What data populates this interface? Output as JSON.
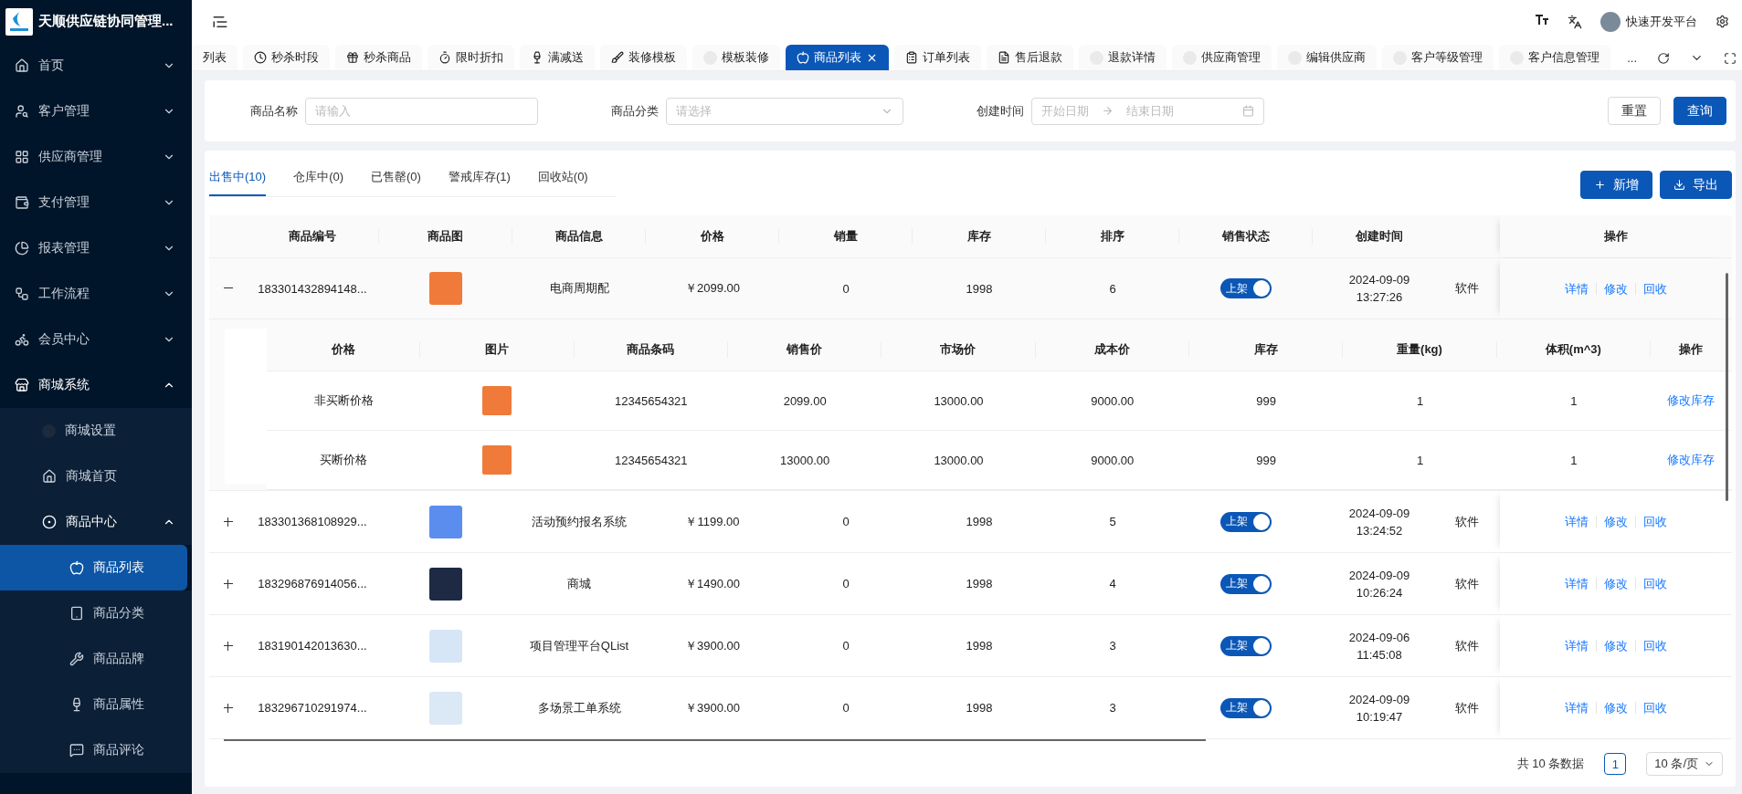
{
  "brand": {
    "title": "天顺供应链协同管理..."
  },
  "user": {
    "name": "快速开发平台"
  },
  "sidebar": {
    "items": [
      {
        "label": "首页",
        "expanded": false,
        "selected": false
      },
      {
        "label": "客户管理",
        "expanded": false,
        "selected": false
      },
      {
        "label": "供应商管理",
        "expanded": false,
        "selected": false
      },
      {
        "label": "支付管理",
        "expanded": false,
        "selected": false
      },
      {
        "label": "报表管理",
        "expanded": false,
        "selected": false
      },
      {
        "label": "工作流程",
        "expanded": false,
        "selected": false
      },
      {
        "label": "会员中心",
        "expanded": false,
        "selected": false
      },
      {
        "label": "商城系统",
        "expanded": true,
        "selected": false,
        "children": [
          {
            "label": "商城设置",
            "selected": false
          },
          {
            "label": "商城首页",
            "selected": false
          },
          {
            "label": "商品中心",
            "expanded": true,
            "selected": false,
            "children": [
              {
                "label": "商品列表",
                "selected": true
              },
              {
                "label": "商品分类",
                "selected": false
              },
              {
                "label": "商品品牌",
                "selected": false
              },
              {
                "label": "商品属性",
                "selected": false
              },
              {
                "label": "商品评论",
                "selected": false
              }
            ]
          }
        ]
      }
    ]
  },
  "tabs": [
    {
      "label": "列表",
      "selected": false,
      "closable": false
    },
    {
      "label": "秒杀时段",
      "selected": false,
      "closable": false
    },
    {
      "label": "秒杀商品",
      "selected": false,
      "closable": false
    },
    {
      "label": "限时折扣",
      "selected": false,
      "closable": false
    },
    {
      "label": "满减送",
      "selected": false,
      "closable": false
    },
    {
      "label": "装修模板",
      "selected": false,
      "closable": false
    },
    {
      "label": "模板装修",
      "selected": false,
      "closable": false
    },
    {
      "label": "商品列表",
      "selected": true,
      "closable": true
    },
    {
      "label": "订单列表",
      "selected": false,
      "closable": false
    },
    {
      "label": "售后退款",
      "selected": false,
      "closable": false
    },
    {
      "label": "退款详情",
      "selected": false,
      "closable": false
    },
    {
      "label": "供应商管理",
      "selected": false,
      "closable": false
    },
    {
      "label": "编辑供应商",
      "selected": false,
      "closable": false
    },
    {
      "label": "客户等级管理",
      "selected": false,
      "closable": false
    },
    {
      "label": "客户信息管理",
      "selected": false,
      "closable": false
    }
  ],
  "tabs_more": "...",
  "filters": [
    {
      "kind": "input",
      "label": "商品名称",
      "placeholder": "请输入"
    },
    {
      "kind": "select",
      "label": "商品分类",
      "placeholder": "请选择"
    },
    {
      "kind": "range",
      "label": "创建时间",
      "placeholder": "开始日期",
      "placeholder_end": "结束日期"
    }
  ],
  "filter_buttons": [
    {
      "label": "重置",
      "kind": "default"
    },
    {
      "label": "查询",
      "kind": "primary"
    }
  ],
  "status_tabs": [
    {
      "label": "出售中(10)",
      "selected": true
    },
    {
      "label": "仓库中(0)",
      "selected": false
    },
    {
      "label": "已售罄(0)",
      "selected": false
    },
    {
      "label": "警戒库存(1)",
      "selected": false
    },
    {
      "label": "回收站(0)",
      "selected": false
    }
  ],
  "actions": [
    {
      "label": "新增",
      "kind": "add"
    },
    {
      "label": "导出",
      "kind": "export"
    }
  ],
  "table": {
    "columns": [
      "商品编号",
      "商品图",
      "商品信息",
      "价格",
      "销量",
      "库存",
      "排序",
      "销售状态",
      "创建时间"
    ],
    "actions_header": "操作",
    "rows": [
      {
        "expanded": true,
        "id": "183301432894148...",
        "title": "电商周期配",
        "price": "￥2099.00",
        "sales": "0",
        "stock": "1998",
        "sort": "6",
        "on": true,
        "status": "上架",
        "created_date": "2024-09-09",
        "created_time": "13:27:26",
        "column_10": "软件",
        "actions": [
          "详情",
          "修改",
          "回收"
        ],
        "sub_table": {
          "columns": [
            "价格",
            "图片",
            "商品条码",
            "销售价",
            "市场价",
            "成本价",
            "库存",
            "重量(kg)",
            "体积(m^3)"
          ],
          "actions_header": "操作",
          "rows": [
            {
              "name": "非买断价格",
              "barcode": "12345654321",
              "sale_price": "2099.00",
              "market_price": "13000.00",
              "cost_price": "9000.00",
              "stock": "999",
              "weight": "1",
              "volume": "1",
              "action": "修改库存"
            },
            {
              "name": "买断价格",
              "barcode": "12345654321",
              "sale_price": "13000.00",
              "market_price": "13000.00",
              "cost_price": "9000.00",
              "stock": "999",
              "weight": "1",
              "volume": "1",
              "action": "修改库存"
            }
          ]
        }
      },
      {
        "expanded": false,
        "id": "183301368108929...",
        "title": "活动预约报名系统",
        "price": "￥1199.00",
        "sales": "0",
        "stock": "1998",
        "sort": "5",
        "on": true,
        "status": "上架",
        "created_date": "2024-09-09",
        "created_time": "13:24:52",
        "column_10": "软件",
        "actions": [
          "详情",
          "修改",
          "回收"
        ]
      },
      {
        "expanded": false,
        "id": "183296876914056...",
        "title": "商城",
        "price": "￥1490.00",
        "sales": "0",
        "stock": "1998",
        "sort": "4",
        "on": true,
        "status": "上架",
        "created_date": "2024-09-09",
        "created_time": "10:26:24",
        "column_10": "软件",
        "actions": [
          "详情",
          "修改",
          "回收"
        ]
      },
      {
        "expanded": false,
        "id": "183190142013630...",
        "title": "项目管理平台QList",
        "price": "￥3900.00",
        "sales": "0",
        "stock": "1998",
        "sort": "3",
        "on": true,
        "status": "上架",
        "created_date": "2024-09-06",
        "created_time": "11:45:08",
        "column_10": "软件",
        "actions": [
          "详情",
          "修改",
          "回收"
        ]
      },
      {
        "expanded": false,
        "id": "183296710291974...",
        "title": "多场景工单系统",
        "price": "￥3900.00",
        "sales": "0",
        "stock": "1998",
        "sort": "3",
        "on": true,
        "status": "上架",
        "created_date": "2024-09-09",
        "created_time": "10:19:47",
        "column_10": "软件",
        "actions": [
          "详情",
          "修改",
          "回收"
        ]
      }
    ]
  },
  "pagination": {
    "total": "共 10 条数据",
    "pages": [
      {
        "label": "1",
        "selected": true
      }
    ],
    "page_size": "10 条/页"
  }
}
